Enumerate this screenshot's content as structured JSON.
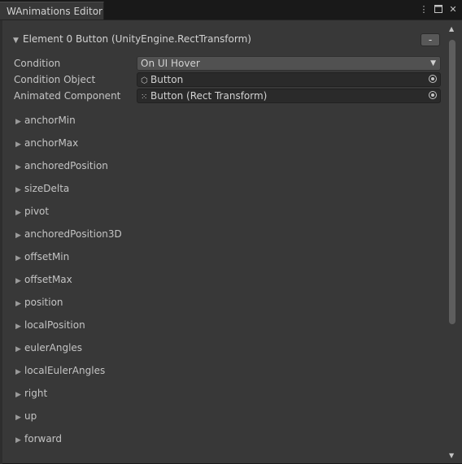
{
  "window": {
    "tab_title": "WAnimations Editor",
    "icons": [
      "more-icon",
      "maximize-icon",
      "close-icon"
    ]
  },
  "element": {
    "header": "Element 0 Button (UnityEngine.RectTransform)",
    "remove_label": "-"
  },
  "fields": {
    "condition_label": "Condition",
    "condition_value": "On UI Hover",
    "condition_object_label": "Condition Object",
    "condition_object_value": "Button",
    "animated_component_label": "Animated Component",
    "animated_component_value": "Button (Rect Transform)"
  },
  "properties": [
    "anchorMin",
    "anchorMax",
    "anchoredPosition",
    "sizeDelta",
    "pivot",
    "anchoredPosition3D",
    "offsetMin",
    "offsetMax",
    "position",
    "localPosition",
    "eulerAngles",
    "localEulerAngles",
    "right",
    "up",
    "forward"
  ],
  "colors": {
    "panel": "#383838",
    "field": "#2a2a2a",
    "dropdown": "#515151",
    "text": "#c4c4c4"
  }
}
